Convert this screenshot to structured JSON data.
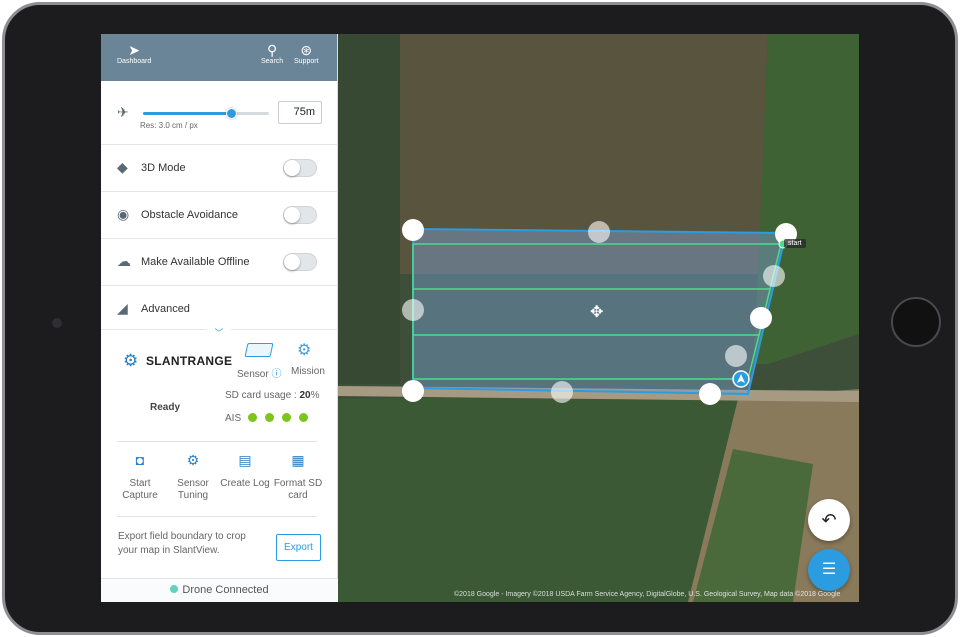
{
  "topbar": {
    "dashboard_label": "Dashboard",
    "search_label": "Search",
    "support_label": "Support"
  },
  "altitude": {
    "value": "75m",
    "resolution_label": "Res: 3.0 cm / px",
    "slider_fraction": 0.7
  },
  "settings": {
    "mode_3d_label": "3D Mode",
    "obstacle_label": "Obstacle Avoidance",
    "offline_label": "Make Available Offline",
    "advanced_label": "Advanced"
  },
  "sensor_panel": {
    "brand": "SLANTRANGE",
    "sensor_label": "Sensor",
    "mission_label": "Mission",
    "status": "Ready",
    "sd_usage_label": "SD card usage :",
    "sd_usage_value": "20",
    "sd_usage_unit": "%",
    "ais_label": "AIS",
    "ais_status_color": "#7cc61b"
  },
  "actions": {
    "start_capture": "Start Capture",
    "sensor_tuning": "Sensor Tuning",
    "create_log": "Create Log",
    "format_sd": "Format SD card"
  },
  "export": {
    "description": "Export field boundary to crop your map in SlantView.",
    "button_label": "Export"
  },
  "status": {
    "drone_connection": "Drone Connected",
    "dot_color": "#5fd3c2"
  },
  "map": {
    "start_label": "start",
    "copyright": "©2018 Google - Imagery ©2018 USDA Farm Service Agency, DigitalGlobe, U.S. Geological Survey, Map data ©2018 Google",
    "accent_color": "#2b9ce0"
  },
  "icons": {
    "dashboard": "back-arrow-icon",
    "search": "search-icon",
    "support": "lifebuoy-icon",
    "altitude": "plane-takeoff-icon",
    "mode_3d": "cube-icon",
    "obstacle": "signal-waves-icon",
    "offline": "cloud-download-icon",
    "advanced": "settings-triangle-icon",
    "slantrange": "gear-icon",
    "undo": "undo-icon",
    "done": "checklist-icon"
  }
}
